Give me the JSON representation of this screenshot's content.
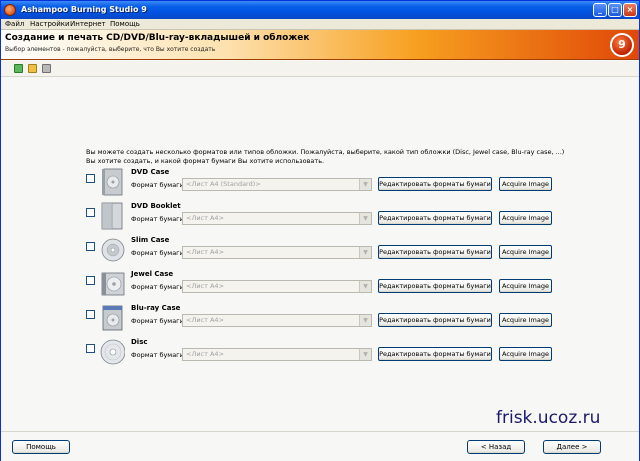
{
  "window": {
    "title": "Ashampoo Burning Studio 9"
  },
  "menu": [
    "Файл",
    "Настройки",
    "Интернет",
    "Помощь"
  ],
  "banner": {
    "title": "Создание и печать CD/DVD/Blu-ray-вкладышей и обложек",
    "subtitle": "Выбор элементов - пожалуйста, выберите, что Вы хотите создать",
    "logo_text": "9"
  },
  "intro": "Вы можете создать несколько форматов или типов обложки. Пожалуйста, выберите, какой тип обложки (Disc, Jewel case, Blu-ray case, ...) Вы хотите создать, и какой формат бумаги Вы хотите использовать.",
  "format_label": "Формат бумаги:",
  "edit_button": "Редактировать форматы бумаги",
  "acquire_button": "Acquire Image",
  "items": [
    {
      "name": "DVD Case",
      "format": "<Лист A4 (Standard)>"
    },
    {
      "name": "DVD Booklet",
      "format": "<Лист A4>"
    },
    {
      "name": "Slim Case",
      "format": "<Лист A4>"
    },
    {
      "name": "Jewel Case",
      "format": "<Лист A4>"
    },
    {
      "name": "Blu-ray Case",
      "format": "<Лист A4>"
    },
    {
      "name": "Disc",
      "format": "<Лист A4>"
    }
  ],
  "footer": {
    "help": "Помощь",
    "back": "< Назад",
    "next": "Далее >"
  },
  "watermark": "frisk.ucoz.ru"
}
